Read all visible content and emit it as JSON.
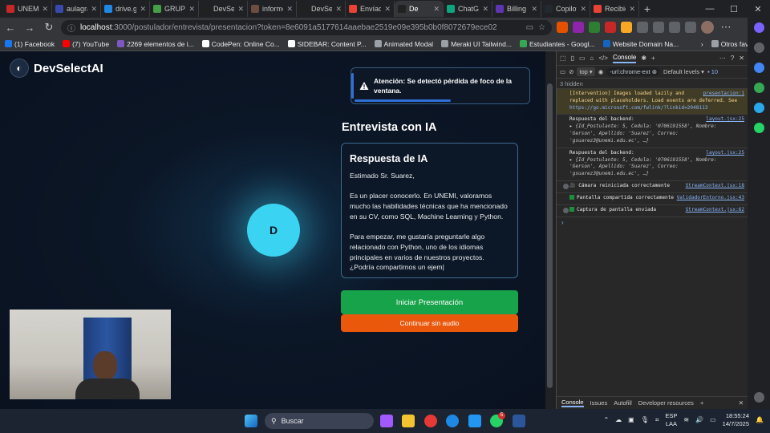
{
  "browser": {
    "tabs": [
      {
        "label": "UNEMI",
        "color": "#c62828"
      },
      {
        "label": "aulagra",
        "color": "#3949ab"
      },
      {
        "label": "drive.g",
        "color": "#1e88e5"
      },
      {
        "label": "GRUPO",
        "color": "#43a047"
      },
      {
        "label": "DevSel",
        "color": "#212121"
      },
      {
        "label": "informe",
        "color": "#6d4c41"
      },
      {
        "label": "DevSel",
        "color": "#212121"
      },
      {
        "label": "Envíad",
        "color": "#ea4335"
      },
      {
        "label": "De",
        "color": "#212121",
        "active": true
      },
      {
        "label": "ChatGP",
        "color": "#10a37f"
      },
      {
        "label": "Billing",
        "color": "#5e35b1"
      },
      {
        "label": "Copilot",
        "color": "#24292f"
      },
      {
        "label": "Recibid",
        "color": "#ea4335"
      }
    ],
    "url_host": "localhost",
    "url_rest": ":3000/postulador/entrevista/presentacion?token=8e6091a5177614aaebae2519e09e395b0b0f8072679ece02",
    "bookmarks": [
      {
        "label": "(1) Facebook",
        "color": "#1877f2"
      },
      {
        "label": "(7) YouTube",
        "color": "#ff0000"
      },
      {
        "label": "2269 elementos de i...",
        "color": "#7e57c2"
      },
      {
        "label": "CodePen: Online Co...",
        "color": "#ffffff"
      },
      {
        "label": "SIDEBAR: Content P...",
        "color": "#ffffff"
      },
      {
        "label": "Animated Modal",
        "color": "#9aa0a6"
      },
      {
        "label": "Meraki UI Tailwind...",
        "color": "#9aa0a6"
      },
      {
        "label": "Estudiantes - Googl...",
        "color": "#34a853"
      },
      {
        "label": "Website Domain Na...",
        "color": "#1565c0"
      }
    ],
    "other_bookmarks": "Otros favoritos"
  },
  "app": {
    "logo_text": "DevSelectAI",
    "avatar_letter": "D",
    "alert_text": "Atención: Se detectó pérdida de foco de la ventana.",
    "interview_title": "Entrevista con IA",
    "response_title": "Respuesta de IA",
    "response_text": "Estimado Sr. Suarez,\n\nEs un placer conocerlo. En UNEMI, valoramos mucho las habilidades técnicas que ha mencionado en su CV, como SQL, Machine Learning y Python.\n\nPara empezar, me gustaría preguntarle algo relacionado con Python, uno de los idiomas principales en varios de nuestros proyectos. ¿Podría compartirnos un ejem|",
    "start_button": "Iniciar Presentación",
    "no_audio_button": "Continuar sin audio"
  },
  "devtools": {
    "tab_console": "Console",
    "context": "top",
    "filter": "-url:chrome-ext",
    "levels": "Default levels",
    "issues_count": "10",
    "hidden": "3 hidden",
    "intervention_text": "[Intervention] Images loaded lazily and replaced with placeholders. Load events are deferred. See",
    "intervention_link": "https://go.microsoft.com/fwlink/?linkid=2048113",
    "intervention_src": "presentacion:1",
    "backend_label": "Respuesta del backend:",
    "backend_obj": "{Id_Postulante: 5, Cedula: '0706191558', Nombre: 'Gerson', Apellido: 'Suarez', Correo: 'gsuarez3@unemi.edu.ec', …}",
    "backend_src": "layout.jsx:25",
    "camera_msg": "🎥 Cámara reiniciada correctamente",
    "camera_src": "StreamContext.jsx:18",
    "screen_msg": "Pantalla compartida correctamente",
    "screen_src": "ValidadorEntorno.jsx:43",
    "capture_msg": "Captura de pantalla enviada",
    "capture_src": "StreamContext.jsx:62",
    "badge_count": "2",
    "drawer_tabs": [
      "Console",
      "Issues",
      "Autofill",
      "Developer resources"
    ]
  },
  "taskbar": {
    "search_label": "Buscar",
    "lang_top": "ESP",
    "lang_bottom": "LAA",
    "time": "18:55:24",
    "date": "14/7/2025",
    "whatsapp_badge": "5"
  }
}
